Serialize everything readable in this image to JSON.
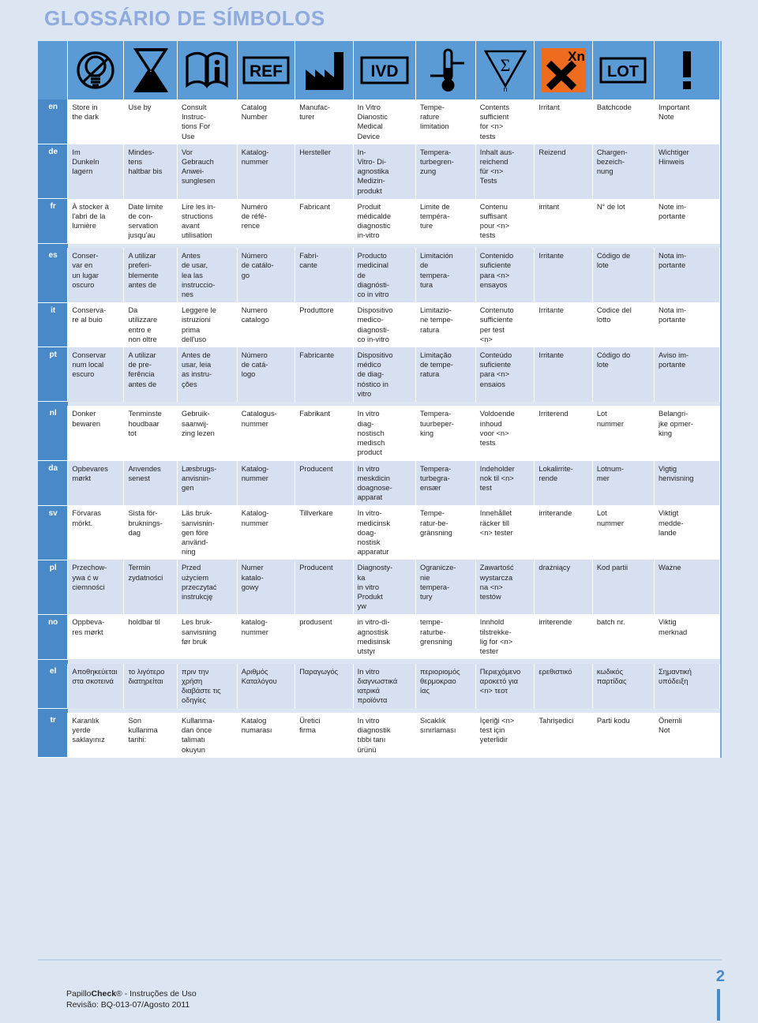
{
  "document": {
    "title": "GLOSSÁRIO DE SÍMBOLOS",
    "page_number": "2",
    "footer_line1_prefix": "Papillo",
    "footer_line1_bold": "Check",
    "footer_line1_suffix": "® - Instruções de Uso",
    "footer_line2": "Revisão: BQ-013-07/Agosto 2011"
  },
  "colors": {
    "title": "#8faadc",
    "header_band": "#5b9bd5",
    "lang_cell": "#4a89c8",
    "row_alt": "#d6e0f0",
    "row_plain": "#ffffff",
    "page_bg": "#dce6f2",
    "hazard_orange": "#ef6c1f"
  },
  "symbols": [
    {
      "name": "store-in-the-dark-icon",
      "label": "no-light-bulb"
    },
    {
      "name": "use-by-icon",
      "label": "hourglass"
    },
    {
      "name": "consult-instructions-icon",
      "label": "book-with-i"
    },
    {
      "name": "catalog-number-icon",
      "label": "REF"
    },
    {
      "name": "manufacturer-icon",
      "label": "factory"
    },
    {
      "name": "in-vitro-diagnostic-icon",
      "label": "IVD"
    },
    {
      "name": "temperature-limitation-icon",
      "label": "thermometer"
    },
    {
      "name": "contents-sufficient-icon",
      "label": "sigma-triangle-n"
    },
    {
      "name": "irritant-icon",
      "label": "Xn"
    },
    {
      "name": "batchcode-icon",
      "label": "LOT"
    },
    {
      "name": "important-note-icon",
      "label": "exclamation"
    }
  ],
  "languages": [
    {
      "code": "en",
      "shade": "plain",
      "cells": [
        "Store in\nthe dark",
        "Use by",
        "Consult\nInstruc-\ntions For\nUse",
        "Catalog\nNumber",
        "Manufac-\nturer",
        "In Vitro\nDianostic\nMedical\nDevice",
        "Tempe-\nrature\nlimitation",
        "Contents\nsufficient\nfor <n>\ntests",
        "Irritant",
        "Batchcode",
        "Important\nNote"
      ]
    },
    {
      "code": "de",
      "shade": "alt",
      "cells": [
        "Im\nDunkeln\nlagern",
        "Mindes-\ntens\nhaltbar bis",
        "Vor\nGebrauch\nAnwei-\nsunglesen",
        "Katalog-\nnummer",
        "Hersteller",
        "In-\nVitro- Di-\nagnostika\nMedizin-\nprodukt",
        "Tempera-\nturbegren-\nzung",
        "Inhalt aus-\nreichend\nfür <n>\nTests",
        "Reizend",
        "Chargen-\nbezeich-\nnung",
        "Wichtiger\nHinweis"
      ]
    },
    {
      "code": "fr",
      "shade": "plain",
      "cells": [
        "À stocker à\nl'abri de la\nlumière",
        "Date limite\nde con-\nservation\njusqu'au",
        "Lire les in-\nstructions\navant\nutilisation",
        "Numéro\nde réfé-\nrence",
        "Fabricant",
        "Produit\nmédicalde\ndiagnostic\nin-vitro",
        "Limite de\ntempéra-\nture",
        "Contenu\nsuffisant\npour <n>\ntests",
        "irritant",
        "N° de lot",
        "Note im-\nportante"
      ]
    },
    {
      "code": "es",
      "shade": "alt",
      "cells": [
        "Conser-\nvar en\nun lugar\noscuro",
        "A utilizar\npreferi-\nblemente\nantes de",
        "Antes\nde usar,\nlea las\ninstruccio-\nnes",
        "Número\nde catálo-\ngo",
        "Fabri-\ncante",
        "Producto\nmedicinal\nde\ndiagnósti-\nco in vitro",
        "Limitación\nde\ntempera-\ntura",
        "Contenido\nsuficiente\npara <n>\nensayos",
        "Irritante",
        "Código de\nlote",
        "Nota im-\nportante"
      ]
    },
    {
      "code": "it",
      "shade": "plain",
      "cells": [
        "Conserva-\nre al buio",
        "Da\nutilizzare\nentro e\nnon oltre",
        "Leggere le\nistruzioni\nprima\ndell'uso",
        "Numero\ncatalogo",
        "Produttore",
        "Dispositivo\nmedico-\ndiagnosti-\nco in-vitro",
        "Limitazio-\nne tempe-\nratura",
        "Contenuto\nsufficiente\nper test\n<n>",
        "Irritante",
        "Codice del\nlotto",
        "Nota im-\nportante"
      ]
    },
    {
      "code": "pt",
      "shade": "alt",
      "cells": [
        "Conservar\nnum local\nescuro",
        "A utilizar\nde pre-\nferência\nantes de",
        "Antes de\nusar, leia\nas instru-\nções",
        "Número\nde catá-\nlogo",
        "Fabricante",
        "Dispositivo\nmédico\nde diag-\nnóstico in\nvitro",
        "Limitação\nde tempe-\nratura",
        "Conteúdo\nsuficiente\npara <n>\nensaios",
        "Irritante",
        "Código do\nlote",
        "Aviso im-\nportante"
      ]
    },
    {
      "code": "nl",
      "shade": "plain",
      "cells": [
        "Donker\nbewaren",
        "Tenminste\nhoudbaar\ntot",
        "Gebruik-\nsaanwij-\nzing lezen",
        "Catalogus-\nnummer",
        "Fabrikant",
        "In vitro\ndiag-\nnostisch\nmedisch\nproduct",
        "Tempera-\ntuurbeper-\nking",
        "Voldoende\ninhoud\nvoor <n>\ntests",
        "Irriterend",
        "Lot\nnummer",
        "Belangri-\njke opmer-\nking"
      ]
    },
    {
      "code": "da",
      "shade": "alt",
      "cells": [
        "Opbevares\nmørkt",
        "Anvendes\nsenest",
        "Læsbrugs-\nanvisnin-\ngen",
        "Katalog-\nnummer",
        "Producent",
        "In vitro\nmeskdicin\ndoagnose-\napparat",
        "Tempera-\nturbegra-\nensær",
        "Indeholder\nnok til <n>\ntest",
        "Lokalirrite-\nrende",
        "Lotnum-\nmer",
        "Vigtig\nhenvisning"
      ]
    },
    {
      "code": "sv",
      "shade": "plain",
      "cells": [
        "Förvaras\nmörkt.",
        "Sista för-\nbruknings-\ndag",
        "Läs bruk-\nsanvisnin-\ngen före\nanvänd-\nning",
        "Katalog-\nnummer",
        "Tillverkare",
        "In vitro-\nmedicinsk\ndoag-\nnostisk\napparatur",
        "Tempe-\nratur-be-\ngränsning",
        "Innehållet\nräcker till\n<n> tester",
        "irriterande",
        "Lot\nnummer",
        "Viktigt\nmedde-\nlande"
      ]
    },
    {
      "code": "pl",
      "shade": "alt",
      "cells": [
        "Przechow-\nywa ć w\nciemności",
        "Termin\nzydatności",
        "Przed\nużyciem\nprzeczytać\ninstrukcję",
        "Numer\nkatalo-\ngowy",
        "Producent",
        "Diagnosty-\nka\nin vitro\nProdukt\nyw",
        "Ogranicze-\nnie\ntempera-\ntury",
        "Zawartość\nwystarcza\nna <n>\ntestów",
        "drażniący",
        "Kod partii",
        "Ważne"
      ]
    },
    {
      "code": "no",
      "shade": "plain",
      "cells": [
        "Oppbeva-\nres mørkt",
        "holdbar til",
        "Les bruk-\nsanvisning\nfør bruk",
        "katalog-\nnummer",
        "produsent",
        "in vitro-di-\nagnostisk\nmedisinsk\nutstyr",
        "tempe-\nraturbe-\ngrensning",
        "Innhold\ntilstrekke-\nlig for <n>\ntester",
        "irriterende",
        "batch nr.",
        "Viktig\nmerknad"
      ]
    },
    {
      "code": "el",
      "shade": "alt",
      "cells": [
        "Αποθηκεύεται\nστα σκοτεινά",
        "το λιγότερο\nδιατηρείται",
        "πριν την\nχρήση\nδιαβάστε τις\nοδηγίες",
        "Αριθμός\nΚαταλόγου",
        "Παραγωγός",
        "In vitro\nδιαγνωστικά\nιατρικά\nπροϊόντα",
        "περιοριομός\nθερμοκραο\nίας",
        "Περιεχόμενο\nαροκετό για\n<n> τεοτ",
        "ερεθιστικό",
        "κωδικός\nπαρτίδας",
        "Σημαντική\nυπόδειξη"
      ]
    },
    {
      "code": "tr",
      "shade": "plain",
      "cells": [
        "Karanlık\nyerde\nsaklayınız",
        "Son\nkullanma\ntarihi:",
        "Kullanma-\ndan önce\ntalimatı\nokuyun",
        "Katalog\nnumarası",
        "Üretici\nfirma",
        "In vitro\ndiagnostik\ntıbbi tanı\nürünü",
        "Sıcaklık\nsınırlaması",
        "İçeriği <n>\ntest için\nyeterlidir",
        "Tahrişedici",
        "Parti kodu",
        "Önemli\nNot"
      ]
    }
  ]
}
